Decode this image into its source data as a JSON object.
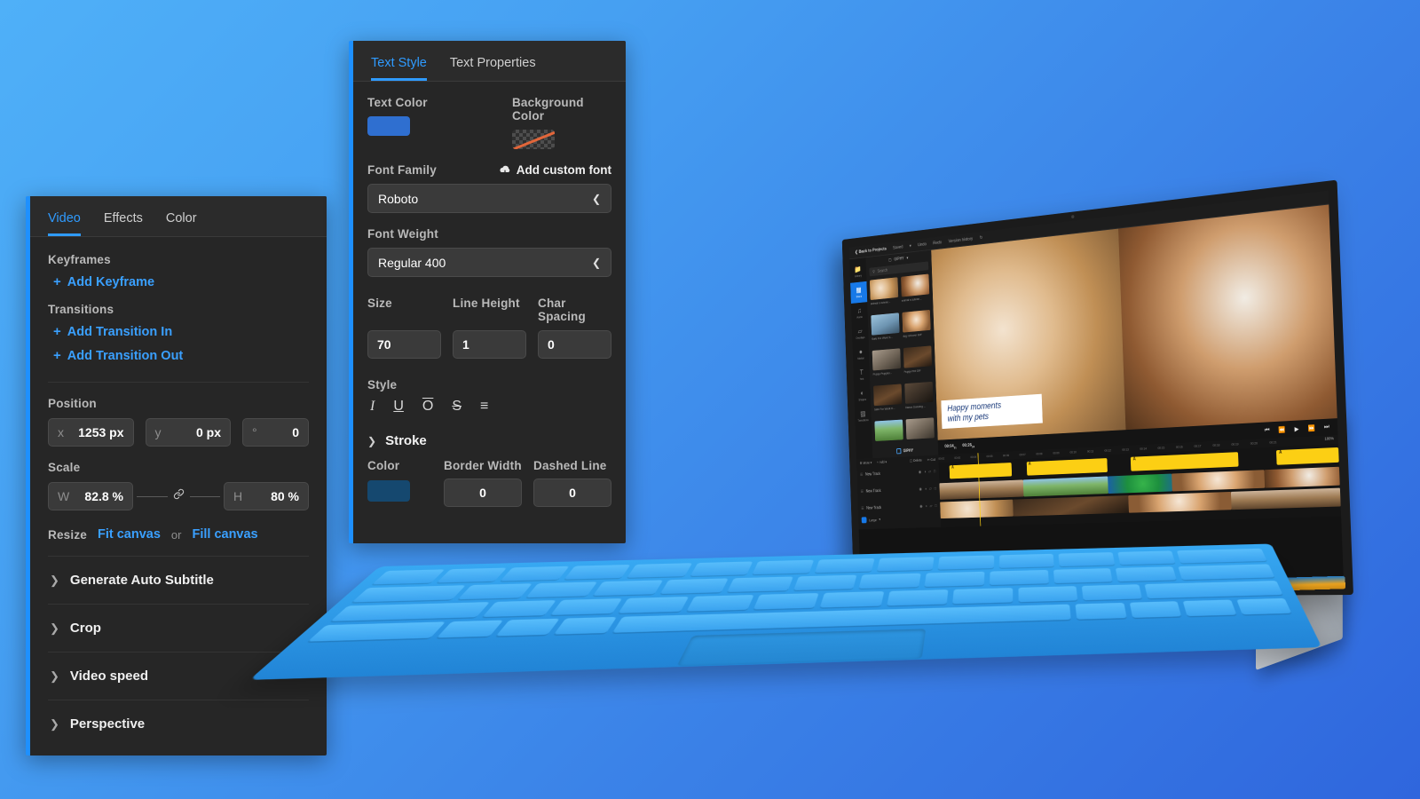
{
  "theme": {
    "accent": "#2f9bff",
    "panel_bg": "#262626",
    "page_gradient_from": "#4fb0f8",
    "page_gradient_to": "#2f66dd"
  },
  "video_panel": {
    "tabs": [
      {
        "label": "Video",
        "active": true
      },
      {
        "label": "Effects",
        "active": false
      },
      {
        "label": "Color",
        "active": false
      }
    ],
    "keyframes": {
      "heading": "Keyframes",
      "add_keyframe": "Add Keyframe"
    },
    "transitions": {
      "heading": "Transitions",
      "add_in": "Add Transition In",
      "add_out": "Add Transition Out"
    },
    "position": {
      "heading": "Position",
      "x_key": "x",
      "x_value": "1253 px",
      "y_key": "y",
      "y_value": "0 px",
      "rotation_key": "°",
      "rotation_value": "0"
    },
    "scale": {
      "heading": "Scale",
      "w_key": "W",
      "w_value": "82.8 %",
      "h_key": "H",
      "h_value": "80 %",
      "link_icon": "chain-link-icon"
    },
    "resize": {
      "label": "Resize",
      "fit": "Fit canvas",
      "or": "or",
      "fill": "Fill canvas"
    },
    "accordions": [
      {
        "label": "Generate Auto Subtitle"
      },
      {
        "label": "Crop"
      },
      {
        "label": "Video speed"
      },
      {
        "label": "Perspective"
      }
    ]
  },
  "text_panel": {
    "tabs": [
      {
        "label": "Text Style",
        "active": true
      },
      {
        "label": "Text Properties",
        "active": false
      }
    ],
    "text_color": {
      "label": "Text Color",
      "value": "#2f6fd0"
    },
    "background_color": {
      "label": "Background Color",
      "value": "none"
    },
    "font_family": {
      "label": "Font Family",
      "value": "Roboto",
      "add_custom": "Add custom font"
    },
    "font_weight": {
      "label": "Font Weight",
      "value": "Regular 400"
    },
    "size": {
      "label": "Size",
      "value": "70"
    },
    "line_height": {
      "label": "Line Height",
      "value": "1"
    },
    "char_spacing": {
      "label": "Char Spacing",
      "value": "0"
    },
    "style": {
      "label": "Style",
      "buttons": [
        "italic-icon",
        "underline-icon",
        "overline-icon",
        "strikethrough-icon",
        "align-icon"
      ],
      "glyphs": [
        "I",
        "U",
        "O",
        "S",
        "☰"
      ]
    },
    "stroke": {
      "label": "Stroke",
      "color_label": "Color",
      "color_value": "#15486f",
      "border_width_label": "Border Width",
      "border_width_value": "0",
      "dashed_line_label": "Dashed Line",
      "dashed_line_value": "0"
    }
  },
  "editor": {
    "topbar": {
      "back": "Back to Projects",
      "saved": "Saved",
      "undo": "Undo",
      "redo": "Redo",
      "version_history": "Version history"
    },
    "rail": [
      {
        "label": "Library",
        "icon": "folder-icon",
        "glyph": "▤",
        "active": false
      },
      {
        "label": "Stock",
        "icon": "stock-icon",
        "glyph": "▣",
        "active": true
      },
      {
        "label": "Audio",
        "icon": "audio-icon",
        "glyph": "♫",
        "active": false
      },
      {
        "label": "Overlays",
        "icon": "overlays-icon",
        "glyph": "▭",
        "active": false
      },
      {
        "label": "Motion",
        "icon": "motion-icon",
        "glyph": "●",
        "active": false
      },
      {
        "label": "Text",
        "icon": "text-icon",
        "glyph": "T",
        "active": false
      },
      {
        "label": "Shapes",
        "icon": "shapes-icon",
        "glyph": "◐",
        "active": false
      },
      {
        "label": "Transitions",
        "icon": "transitions-icon",
        "glyph": "◨",
        "active": false
      }
    ],
    "library": {
      "source": "GIPHY",
      "search_placeholder": "Search",
      "search_icon": "search-icon",
      "powered_by": "GIPHY",
      "items": [
        {
          "caption": "animal s cutene...",
          "art": "ph-cat"
        },
        {
          "caption": "animal s cutene...",
          "art": "ph-dog"
        },
        {
          "caption": "Safe For Work S...",
          "art": "ph-blue"
        },
        {
          "caption": "dog roll over GIF",
          "art": "ph-pup"
        },
        {
          "caption": "Puppy Puppies...",
          "art": "ph-stone"
        },
        {
          "caption": "Puppy Pet GIF",
          "art": "ph-dark"
        },
        {
          "caption": "Safe For Work D...",
          "art": "ph-room"
        },
        {
          "caption": "Dance Dancing ...",
          "art": "ph-room"
        },
        {
          "caption": "",
          "art": "ph-grass"
        },
        {
          "caption": "",
          "art": "ph-stone"
        }
      ]
    },
    "preview": {
      "caption_line1": "Happy moments",
      "caption_line2": "with my pets",
      "caption_color": "#1a3a7a",
      "current_time": "00:04",
      "current_frames": "31",
      "total_time": "00:26",
      "total_frames": "24",
      "transport": [
        {
          "name": "skip-start-icon",
          "glyph": "⏮"
        },
        {
          "name": "rewind-icon",
          "glyph": "⏪"
        },
        {
          "name": "play-icon",
          "glyph": "▶"
        },
        {
          "name": "fast-forward-icon",
          "glyph": "⏩"
        },
        {
          "name": "skip-end-icon",
          "glyph": "⏭"
        }
      ]
    },
    "timeline": {
      "more": "More",
      "add": "Add",
      "delete": "Delete",
      "cut": "Cut",
      "zoom_level": "100%",
      "size_label": "Large",
      "tracks": [
        {
          "label": "New Track"
        },
        {
          "label": "New Track"
        },
        {
          "label": "New Track"
        }
      ],
      "track_actions": [
        "eye-icon",
        "mute-icon",
        "lock-icon",
        "trash-icon"
      ],
      "track_action_glyphs": [
        "◉",
        "◑",
        "▭",
        "□"
      ],
      "ruler_ticks": [
        "00:02",
        "00:03",
        "00:04",
        "00:05",
        "00:06",
        "00:07",
        "00:08",
        "00:09",
        "00:10",
        "00:11",
        "00:12",
        "00:13",
        "00:14",
        "00:15",
        "00:16",
        "00:17",
        "00:18",
        "00:19",
        "00:20",
        "00:21"
      ],
      "text_clips": [
        {
          "label": "A",
          "left_pct": 3,
          "width_pct": 17
        },
        {
          "label": "A",
          "left_pct": 24,
          "width_pct": 21
        },
        {
          "label": "A",
          "left_pct": 51,
          "width_pct": 26
        },
        {
          "label": "A",
          "left_pct": 86,
          "width_pct": 14
        }
      ],
      "video_clips": [
        {
          "art": "ph-cows",
          "left_pct": 0,
          "width_pct": 23
        },
        {
          "art": "ph-grass",
          "left_pct": 23,
          "width_pct": 22
        },
        {
          "art": "ph-bird",
          "left_pct": 45,
          "width_pct": 16
        },
        {
          "art": "ph-pup",
          "left_pct": 61,
          "width_pct": 22
        },
        {
          "art": "ph-dog",
          "left_pct": 83,
          "width_pct": 17
        }
      ],
      "video_clips_b": [
        {
          "art": "ph-cat",
          "left_pct": 0,
          "width_pct": 20
        },
        {
          "art": "ph-dark",
          "left_pct": 20,
          "width_pct": 30
        },
        {
          "art": "ph-pup",
          "left_pct": 50,
          "width_pct": 25
        },
        {
          "art": "ph-cows",
          "left_pct": 75,
          "width_pct": 25
        }
      ]
    }
  }
}
